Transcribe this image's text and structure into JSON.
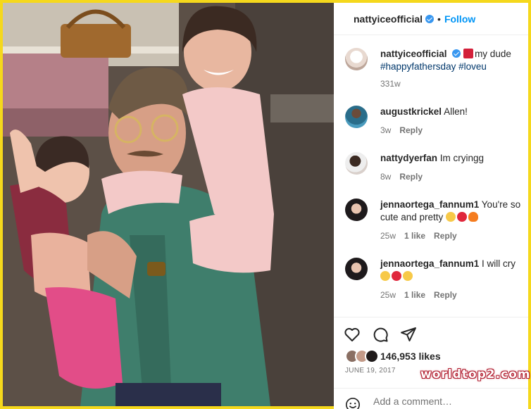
{
  "header": {
    "username": "nattyiceofficial",
    "separator": "•",
    "follow_label": "Follow"
  },
  "caption": {
    "username": "nattyiceofficial",
    "text": "my dude",
    "hashtags": "#happyfathersday #loveu",
    "time": "331w"
  },
  "comments": [
    {
      "username": "augustkrickel",
      "text": "Allen!",
      "time": "3w",
      "likes": "",
      "reply_label": "Reply"
    },
    {
      "username": "nattydyerfan",
      "text": "Im cryingg",
      "time": "8w",
      "likes": "",
      "reply_label": "Reply"
    },
    {
      "username": "jennaortega_fannum1",
      "text": "You're so cute and pretty",
      "time": "25w",
      "likes": "1 like",
      "reply_label": "Reply"
    },
    {
      "username": "jennaortega_fannum1",
      "text": "I will cry",
      "time": "25w",
      "likes": "1 like",
      "reply_label": "Reply"
    }
  ],
  "post": {
    "likes": "146,953 likes",
    "date": "JUNE 19, 2017",
    "add_comment_placeholder": "Add a comment…"
  },
  "icons": [
    "heart-icon",
    "comment-icon",
    "share-icon",
    "smile-icon",
    "verified-badge-icon"
  ],
  "colors": {
    "accent": "#0095f6",
    "verified": "#3897f0",
    "frame": "#f5d81c",
    "heart": "#ed4956"
  },
  "watermark": "worldtop2.com"
}
